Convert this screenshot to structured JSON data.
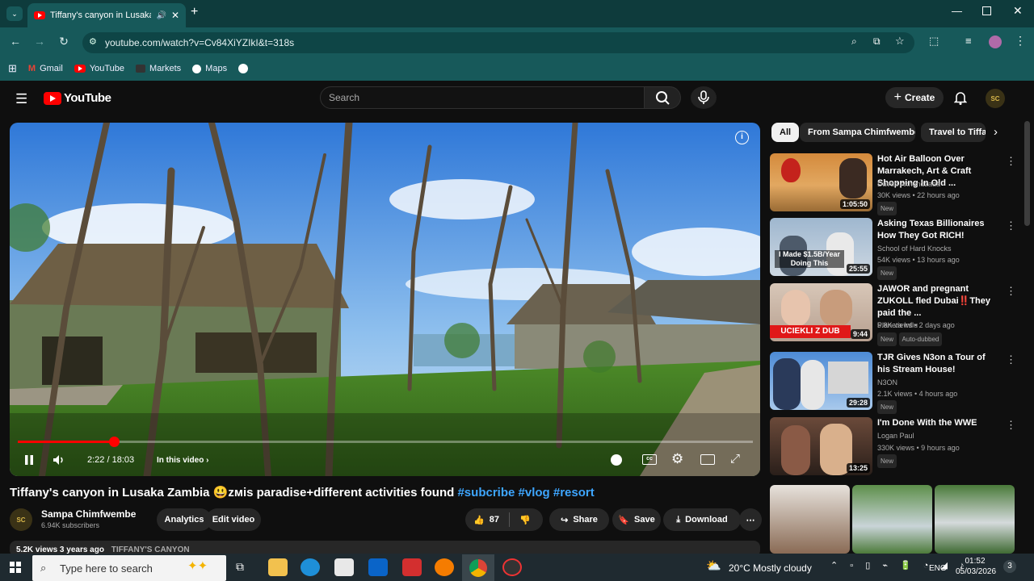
{
  "browser": {
    "tab_title": "Tiffany's canyon in Lusaka Z",
    "url": "youtube.com/watch?v=Cv84XiYZIkI&t=318s",
    "bookmarks": [
      "Gmail",
      "YouTube",
      "Markets",
      "Maps"
    ]
  },
  "yt": {
    "logo": "YouTube",
    "search_placeholder": "Search",
    "create_label": "Create",
    "avatar_initials": "SC"
  },
  "player": {
    "time": "2:22 / 18:03",
    "in_this_video": "In this video",
    "progress_fraction": 0.131
  },
  "video": {
    "title": "Tiffany's canyon in Lusaka Zambia 😃ᴢᴍis paradise+different activities found",
    "hashtags": [
      "#subcribe",
      "#vlog",
      "#resort"
    ],
    "channel_name": "Sampa Chimfwembe",
    "subscribers": "6.94K subscribers",
    "analytics_label": "Analytics",
    "edit_label": "Edit video",
    "likes": "87",
    "share_label": "Share",
    "save_label": "Save",
    "download_label": "Download",
    "desc_meta": "5.2K views 3 years ago",
    "desc_tag": "TIFFANY'S CANYON"
  },
  "chips": [
    "All",
    "From Sampa Chimfwembe",
    "Travel to Tiffa"
  ],
  "recommendations": [
    {
      "title": "Hot Air Balloon Over Marrakech, Art & Craft Shopping In Old ...",
      "channel": "Davud Akhundzada",
      "meta": "30K views • 22 hours ago",
      "badge": "New",
      "duration": "1:05:50"
    },
    {
      "title": "Asking Texas Billionaires How They Got RICH!",
      "channel": "School of Hard Knocks",
      "meta": "54K views • 13 hours ago",
      "badge": "New",
      "duration": "25:55",
      "thumb_text": "I Made $1.5B/Year Doing This"
    },
    {
      "title": "JAWOR and pregnant ZUKOLL fled Dubai‼️They paid the ...",
      "channel": "Planeta Influ",
      "meta": "5.8K views • 2 days ago",
      "badge": "New",
      "badge2": "Auto-dubbed",
      "duration": "9:44",
      "thumb_text": "UCIEKLI Z DUB"
    },
    {
      "title": "TJR Gives N3on a Tour of his Stream House!",
      "channel": "N3ON",
      "meta": "2.1K views • 4 hours ago",
      "badge": "New",
      "duration": "29:28"
    },
    {
      "title": "I'm Done With the WWE",
      "channel": "Logan Paul",
      "meta": "330K views • 9 hours ago",
      "badge": "New",
      "duration": "13:25"
    }
  ],
  "taskbar": {
    "search_placeholder": "Type here to search",
    "weather": "20°C  Mostly cloudy",
    "lang": "ENG",
    "time": "01:52",
    "date": "05/03/2026"
  }
}
